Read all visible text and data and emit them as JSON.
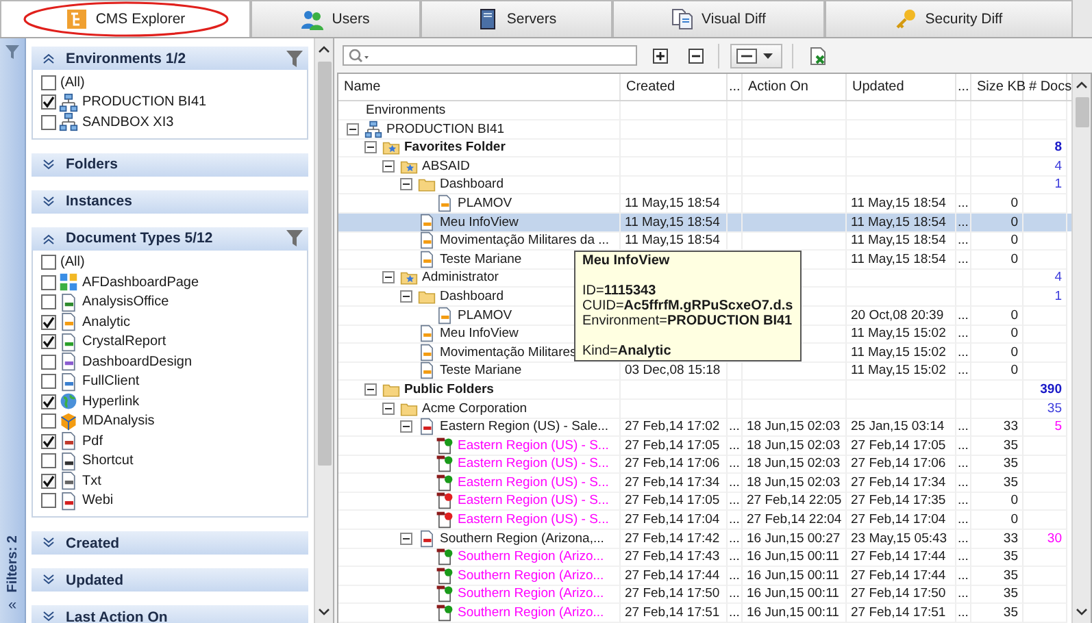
{
  "tabs": [
    {
      "label": "CMS Explorer",
      "kind": "cms",
      "selected": true
    },
    {
      "label": "Users",
      "kind": "users",
      "selected": false
    },
    {
      "label": "Servers",
      "kind": "servers",
      "selected": false
    },
    {
      "label": "Visual Diff",
      "kind": "diff",
      "selected": false
    },
    {
      "label": "Security Diff",
      "kind": "key",
      "selected": false
    }
  ],
  "filter_strip": {
    "label": "Filters: 2",
    "collapse": "«"
  },
  "filter_sections": [
    {
      "title": "Environments 1/2",
      "expanded": true,
      "items": [
        {
          "label": "(All)",
          "kind": "all",
          "checked": false
        },
        {
          "label": "PRODUCTION BI41",
          "kind": "server",
          "checked": true
        },
        {
          "label": "SANDBOX XI3",
          "kind": "server",
          "checked": false
        }
      ]
    },
    {
      "title": "Folders",
      "expanded": false
    },
    {
      "title": "Instances",
      "expanded": false
    },
    {
      "title": "Document Types 5/12",
      "expanded": true,
      "items": [
        {
          "label": "(All)",
          "kind": "all",
          "checked": false
        },
        {
          "label": "AFDashboardPage",
          "kind": "dashboard_page",
          "checked": false
        },
        {
          "label": "AnalysisOffice",
          "kind": "analysis_office",
          "checked": false
        },
        {
          "label": "Analytic",
          "kind": "analytic",
          "checked": true
        },
        {
          "label": "CrystalReport",
          "kind": "crystal",
          "checked": true
        },
        {
          "label": "DashboardDesign",
          "kind": "dashboard_design",
          "checked": false
        },
        {
          "label": "FullClient",
          "kind": "fullclient",
          "checked": false
        },
        {
          "label": "Hyperlink",
          "kind": "hyperlink",
          "checked": true
        },
        {
          "label": "MDAnalysis",
          "kind": "mdanalysis",
          "checked": false
        },
        {
          "label": "Pdf",
          "kind": "pdf",
          "checked": true
        },
        {
          "label": "Shortcut",
          "kind": "shortcut",
          "checked": false
        },
        {
          "label": "Txt",
          "kind": "txt",
          "checked": true
        },
        {
          "label": "Webi",
          "kind": "webi",
          "checked": false
        }
      ]
    },
    {
      "title": "Created",
      "expanded": false
    },
    {
      "title": "Updated",
      "expanded": false
    },
    {
      "title": "Last Action On",
      "expanded": false
    }
  ],
  "table": {
    "columns": [
      "Name",
      "Created",
      "...",
      "Action On",
      "Updated",
      "...",
      "Size KB",
      "# Docs"
    ],
    "rows": [
      {
        "name": "Environments",
        "kind": "group",
        "selected": false
      },
      {
        "name": "PRODUCTION BI41",
        "kind": "server",
        "selected": false,
        "expanded": true,
        "children": [
          {
            "name": "Favorites Folder",
            "kind": "favorites_folder",
            "selected": false,
            "expanded": true,
            "cells": {
              "docs": "8"
            },
            "children": [
              {
                "name": "ABSAID",
                "kind": "user_folder",
                "selected": false,
                "expanded": true,
                "cells": {
                  "docs": "4"
                },
                "children": [
                  {
                    "name": "Dashboard",
                    "kind": "folder",
                    "selected": false,
                    "expanded": true,
                    "cells": {
                      "docs": "1"
                    },
                    "children": [
                      {
                        "name": "PLAMOV",
                        "kind": "analytic",
                        "selected": false,
                        "cells": {
                          "created": "11 May,15 18:54",
                          "updated": "11 May,15 18:54",
                          "col_6": "...",
                          "size_kb": "0"
                        }
                      }
                    ]
                  },
                  {
                    "name": "Meu InfoView",
                    "kind": "analytic",
                    "selected": true,
                    "cells": {
                      "created": "11 May,15 18:54",
                      "updated": "11 May,15 18:54",
                      "col_6": "...",
                      "size_kb": "0"
                    }
                  },
                  {
                    "name": "Movimentação Militares da ...",
                    "kind": "analytic",
                    "selected": false,
                    "cells": {
                      "created": "11 May,15 18:54",
                      "updated": "11 May,15 18:54",
                      "col_6": "...",
                      "size_kb": "0"
                    }
                  },
                  {
                    "name": "Teste Mariane",
                    "kind": "analytic",
                    "selected": false,
                    "cells": {
                      "updated": "11 May,15 18:54",
                      "col_6": "...",
                      "size_kb": "0"
                    }
                  }
                ]
              },
              {
                "name": "Administrator",
                "kind": "user_folder",
                "selected": false,
                "expanded": true,
                "cells": {
                  "docs": "4"
                },
                "children": [
                  {
                    "name": "Dashboard",
                    "kind": "folder",
                    "selected": false,
                    "expanded": true,
                    "cells": {
                      "docs": "1"
                    },
                    "children": [
                      {
                        "name": "PLAMOV",
                        "kind": "analytic",
                        "selected": false,
                        "cells": {
                          "updated": "20 Oct,08 20:39",
                          "col_6": "...",
                          "size_kb": "0"
                        }
                      }
                    ]
                  },
                  {
                    "name": "Meu InfoView",
                    "kind": "analytic",
                    "selected": false,
                    "cells": {
                      "updated": "11 May,15 15:02",
                      "col_6": "...",
                      "size_kb": "0"
                    }
                  },
                  {
                    "name": "Movimentação Militares",
                    "kind": "analytic",
                    "selected": false,
                    "cells": {
                      "updated": "11 May,15 15:02",
                      "col_6": "...",
                      "size_kb": "0"
                    }
                  },
                  {
                    "name": "Teste Mariane",
                    "kind": "analytic",
                    "selected": false,
                    "cells": {
                      "created": "03 Dec,08 15:18",
                      "updated": "11 May,15 15:02",
                      "col_6": "...",
                      "size_kb": "0"
                    }
                  }
                ]
              }
            ]
          },
          {
            "name": "Public Folders",
            "kind": "public_folder",
            "selected": false,
            "expanded": true,
            "cells": {
              "docs": "390"
            },
            "children": [
              {
                "name": "Acme Corporation",
                "kind": "folder",
                "selected": false,
                "expanded": true,
                "cells": {
                  "docs": "35"
                },
                "children": [
                  {
                    "name": "Eastern Region (US) - Sale...",
                    "kind": "webi",
                    "selected": false,
                    "expanded": true,
                    "cells": {
                      "created": "27 Feb,14 17:02",
                      "col_3": "...",
                      "action_on": "18 Jun,15 02:03",
                      "updated": "25 Jan,15 03:14",
                      "col_6": "...",
                      "size_kb": "33",
                      "docs": "5"
                    },
                    "children": [
                      {
                        "name": "Eastern Region (US) - S...",
                        "kind": "instance_ok",
                        "selected": false,
                        "cells": {
                          "created": "27 Feb,14 17:05",
                          "col_3": "...",
                          "action_on": "18 Jun,15 02:03",
                          "updated": "27 Feb,14 17:05",
                          "col_6": "...",
                          "size_kb": "35"
                        }
                      },
                      {
                        "name": "Eastern Region (US) - S...",
                        "kind": "instance_ok",
                        "selected": false,
                        "cells": {
                          "created": "27 Feb,14 17:06",
                          "col_3": "...",
                          "action_on": "18 Jun,15 02:03",
                          "updated": "27 Feb,14 17:06",
                          "col_6": "...",
                          "size_kb": "35"
                        }
                      },
                      {
                        "name": "Eastern Region (US) - S...",
                        "kind": "instance_ok",
                        "selected": false,
                        "cells": {
                          "created": "27 Feb,14 17:34",
                          "col_3": "...",
                          "action_on": "18 Jun,15 02:03",
                          "updated": "27 Feb,14 17:34",
                          "col_6": "...",
                          "size_kb": "35"
                        }
                      },
                      {
                        "name": "Eastern Region (US) - S...",
                        "kind": "instance_failed",
                        "selected": false,
                        "cells": {
                          "created": "27 Feb,14 17:05",
                          "col_3": "...",
                          "action_on": "27 Feb,14 22:05",
                          "updated": "27 Feb,14 17:35",
                          "col_6": "...",
                          "size_kb": "0"
                        }
                      },
                      {
                        "name": "Eastern Region (US) - S...",
                        "kind": "instance_failed",
                        "selected": false,
                        "cells": {
                          "created": "27 Feb,14 17:04",
                          "col_3": "...",
                          "action_on": "27 Feb,14 22:04",
                          "updated": "27 Feb,14 17:04",
                          "col_6": "...",
                          "size_kb": "0"
                        }
                      }
                    ]
                  },
                  {
                    "name": "Southern Region (Arizona,...",
                    "kind": "webi",
                    "selected": false,
                    "expanded": true,
                    "cells": {
                      "created": "27 Feb,14 17:42",
                      "col_3": "...",
                      "action_on": "16 Jun,15 00:27",
                      "updated": "23 May,15 05:43",
                      "col_6": "...",
                      "size_kb": "33",
                      "docs": "30"
                    },
                    "children": [
                      {
                        "name": "Southern Region (Arizo...",
                        "kind": "instance_ok",
                        "selected": false,
                        "cells": {
                          "created": "27 Feb,14 17:43",
                          "col_3": "...",
                          "action_on": "16 Jun,15 00:11",
                          "updated": "27 Feb,14 17:44",
                          "col_6": "...",
                          "size_kb": "35"
                        }
                      },
                      {
                        "name": "Southern Region (Arizo...",
                        "kind": "instance_ok",
                        "selected": false,
                        "cells": {
                          "created": "27 Feb,14 17:44",
                          "col_3": "...",
                          "action_on": "16 Jun,15 00:11",
                          "updated": "27 Feb,14 17:44",
                          "col_6": "...",
                          "size_kb": "35"
                        }
                      },
                      {
                        "name": "Southern Region (Arizo...",
                        "kind": "instance_ok",
                        "selected": false,
                        "cells": {
                          "created": "27 Feb,14 17:50",
                          "col_3": "...",
                          "action_on": "16 Jun,15 00:11",
                          "updated": "27 Feb,14 17:50",
                          "col_6": "...",
                          "size_kb": "35"
                        }
                      },
                      {
                        "name": "Southern Region (Arizo...",
                        "kind": "instance_ok",
                        "selected": false,
                        "cells": {
                          "created": "27 Feb,14 17:51",
                          "col_3": "...",
                          "action_on": "16 Jun,15 00:11",
                          "updated": "27 Feb,14 17:51",
                          "col_6": "...",
                          "size_kb": "35"
                        }
                      }
                    ]
                  }
                ]
              }
            ]
          }
        ]
      }
    ]
  },
  "tooltip": {
    "title": "Meu InfoView",
    "details": [
      "ID=**1115343**",
      "CUID=**Ac5ffrfM.gRPuScxeO7.d.s**",
      "Environment=**PRODUCTION BI41**"
    ],
    "kind_line": "Kind=**Analytic**"
  }
}
